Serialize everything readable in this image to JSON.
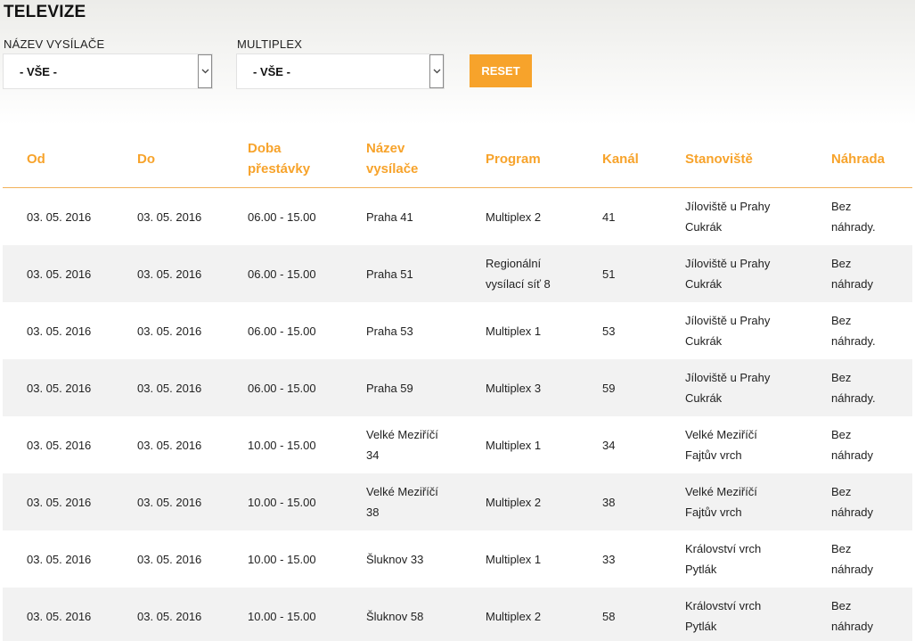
{
  "page": {
    "title": "TELEVIZE"
  },
  "filters": {
    "transmitter_label": "NÁZEV VYSÍLAČE",
    "transmitter_value": "- VŠE -",
    "multiplex_label": "MULTIPLEX",
    "multiplex_value": "- VŠE -",
    "reset_label": "RESET"
  },
  "colors": {
    "accent": "#f7a32b",
    "row_alt": "#f2f2f2"
  },
  "table": {
    "headers": [
      "Od",
      "Do",
      "Doba přestávky",
      "Název vysílače",
      "Program",
      "Kanál",
      "Stanoviště",
      "Náhrada"
    ],
    "rows": [
      [
        "03. 05. 2016",
        "03. 05. 2016",
        "06.00 - 15.00",
        "Praha 41",
        "Multiplex 2",
        "41",
        "Jíloviště u Prahy Cukrák",
        "Bez náhrady."
      ],
      [
        "03. 05. 2016",
        "03. 05. 2016",
        "06.00 - 15.00",
        "Praha 51",
        "Regionální vysílací síť 8",
        "51",
        "Jíloviště u Prahy Cukrák",
        "Bez náhrady"
      ],
      [
        "03. 05. 2016",
        "03. 05. 2016",
        "06.00 - 15.00",
        "Praha 53",
        "Multiplex 1",
        "53",
        "Jíloviště u Prahy Cukrák",
        "Bez náhrady."
      ],
      [
        "03. 05. 2016",
        "03. 05. 2016",
        "06.00 - 15.00",
        "Praha 59",
        "Multiplex 3",
        "59",
        "Jíloviště u Prahy Cukrák",
        "Bez náhrady."
      ],
      [
        "03. 05. 2016",
        "03. 05. 2016",
        "10.00 - 15.00",
        "Velké Meziříčí 34",
        "Multiplex 1",
        "34",
        "Velké Meziříčí Fajtův vrch",
        "Bez náhrady"
      ],
      [
        "03. 05. 2016",
        "03. 05. 2016",
        "10.00 - 15.00",
        "Velké Meziříčí 38",
        "Multiplex 2",
        "38",
        "Velké Meziříčí Fajtův vrch",
        "Bez náhrady"
      ],
      [
        "03. 05. 2016",
        "03. 05. 2016",
        "10.00 - 15.00",
        "Šluknov 33",
        "Multiplex 1",
        "33",
        "Království vrch Pytlák",
        "Bez náhrady"
      ],
      [
        "03. 05. 2016",
        "03. 05. 2016",
        "10.00 - 15.00",
        "Šluknov 58",
        "Multiplex 2",
        "58",
        "Království vrch Pytlák",
        "Bez náhrady"
      ]
    ]
  }
}
